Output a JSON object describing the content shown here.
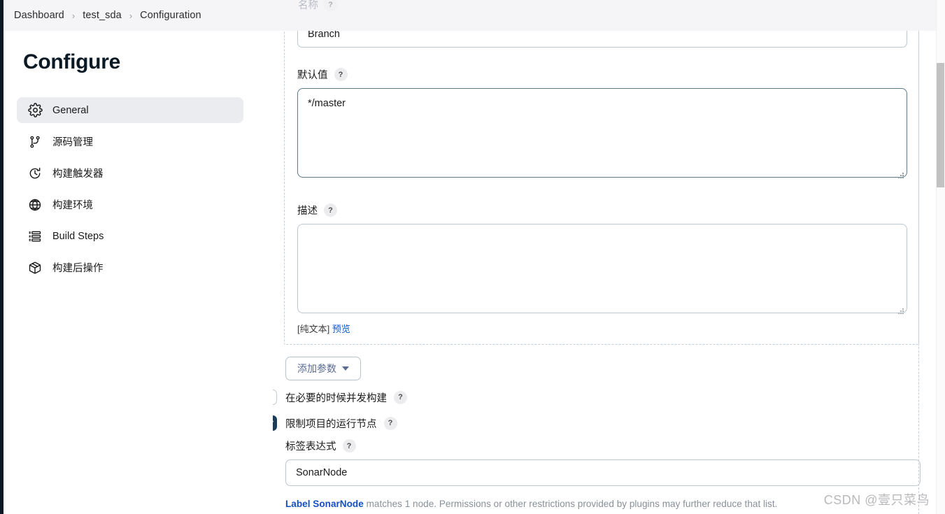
{
  "breadcrumb": {
    "items": [
      "Dashboard",
      "test_sda",
      "Configuration"
    ],
    "separator": "›"
  },
  "sidebar": {
    "title": "Configure",
    "items": [
      {
        "label": "General",
        "icon": "gear-icon",
        "active": true
      },
      {
        "label": "源码管理",
        "icon": "source-control-icon",
        "active": false
      },
      {
        "label": "构建触发器",
        "icon": "clock-icon",
        "active": false
      },
      {
        "label": "构建环境",
        "icon": "globe-icon",
        "active": false
      },
      {
        "label": "Build Steps",
        "icon": "list-icon",
        "active": false
      },
      {
        "label": "构建后操作",
        "icon": "package-icon",
        "active": false
      }
    ]
  },
  "form": {
    "help_glyph": "?",
    "name_field": {
      "label": "名称",
      "value": "Branch",
      "placeholder": ""
    },
    "default_value_field": {
      "label": "默认值",
      "value": "*/master",
      "placeholder": ""
    },
    "description_field": {
      "label": "描述",
      "value": "",
      "placeholder": "",
      "plaintext_note": "[纯文本]",
      "preview_link": "预览"
    },
    "add_parameter_button": "添加参数",
    "checkboxes": [
      {
        "label": "在必要的时候并发构建",
        "checked": false
      },
      {
        "label": "限制项目的运行节点",
        "checked": true
      }
    ],
    "label_expression": {
      "label": "标签表达式",
      "value": "SonarNode",
      "placeholder": "",
      "hint_link": "Label SonarNode",
      "hint_rest": " matches 1 node. Permissions or other restrictions provided by plugins may further reduce that list."
    }
  },
  "watermark": "CSDN @壹只菜鸟",
  "colors": {
    "rail": "#0b1924",
    "breadcrumb_bg": "#f5f5f7",
    "active_nav_bg": "#ebecef",
    "focus_border": "#5d7b8c",
    "input_border": "#bcc7ce",
    "link": "#0b57d0",
    "hint_link": "#1350c4",
    "checkbox_checked": "#1c3d5a",
    "button_text": "#5b6b93",
    "dashed_border": "#c3ced6"
  }
}
